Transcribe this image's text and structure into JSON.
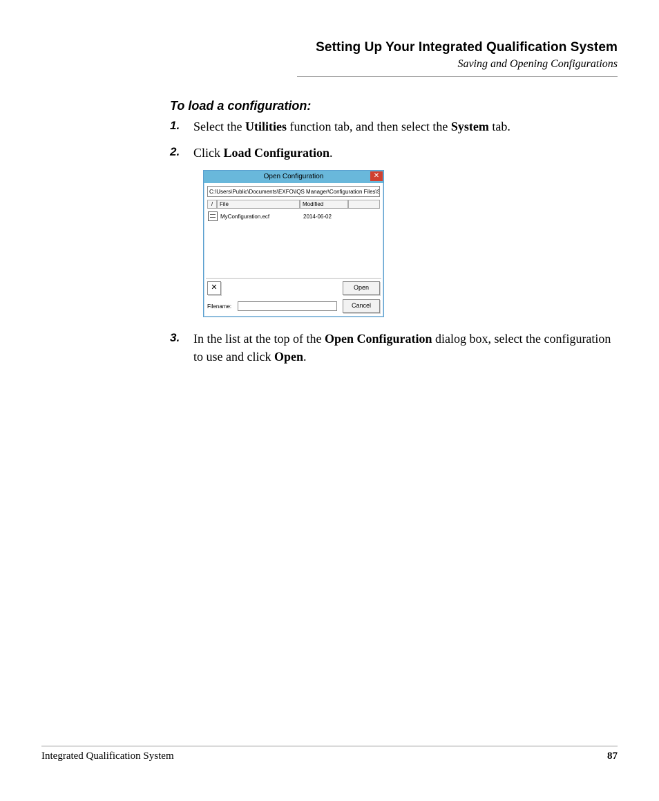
{
  "header": {
    "chapter_title": "Setting Up Your Integrated Qualification System",
    "section_title": "Saving and Opening Configurations"
  },
  "lead": "To load a configuration:",
  "steps": [
    {
      "num": "1.",
      "segments": [
        {
          "t": "Select the "
        },
        {
          "t": "Utilities",
          "b": true
        },
        {
          "t": " function tab, and then select the "
        },
        {
          "t": "System",
          "b": true
        },
        {
          "t": " tab."
        }
      ]
    },
    {
      "num": "2.",
      "segments": [
        {
          "t": "Click "
        },
        {
          "t": "Load Configuration",
          "b": true
        },
        {
          "t": "."
        }
      ]
    },
    {
      "num": "3.",
      "segments": [
        {
          "t": "In the list at the top of the "
        },
        {
          "t": "Open Configuration",
          "b": true
        },
        {
          "t": " dialog box, select the configuration to use and click "
        },
        {
          "t": "Open",
          "b": true
        },
        {
          "t": "."
        }
      ]
    }
  ],
  "dialog": {
    "title": "Open Configuration",
    "close_glyph": "✕",
    "path": "C:\\Users\\Public\\Documents\\EXFO\\IQS Manager\\Configuration Files\\ShellMoc",
    "columns": {
      "slash": "/",
      "file": "File",
      "modified": "Modified"
    },
    "rows": [
      {
        "name": "MyConfiguration.ecf",
        "modified": "2014-06-02"
      }
    ],
    "delete_glyph": "✕",
    "open_label": "Open",
    "cancel_label": "Cancel",
    "filename_label": "Filename:"
  },
  "footer": {
    "left": "Integrated Qualification System",
    "right": "87"
  }
}
